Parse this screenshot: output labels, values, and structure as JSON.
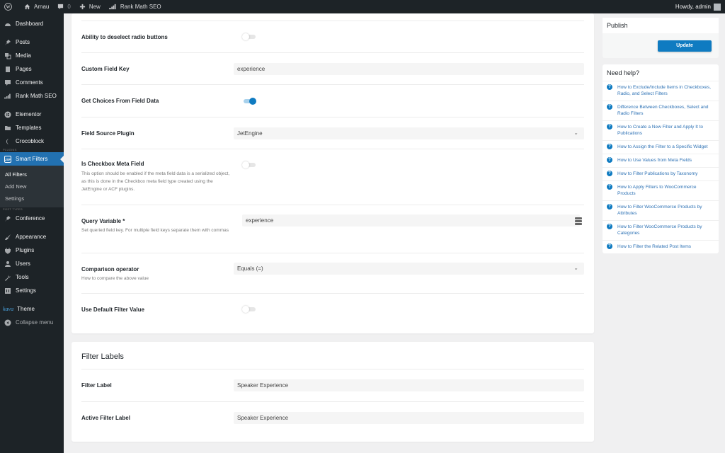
{
  "adminbar": {
    "site_name": "Arnau",
    "comments_count": "0",
    "new_label": "New",
    "rankmath_label": "Rank Math SEO",
    "howdy": "Howdy, admin"
  },
  "sidebar": {
    "items_top": [
      {
        "label": "Dashboard",
        "icon": "dashboard-icon"
      },
      {
        "label": "Posts",
        "icon": "pin-icon"
      },
      {
        "label": "Media",
        "icon": "media-icon"
      },
      {
        "label": "Pages",
        "icon": "pages-icon"
      },
      {
        "label": "Comments",
        "icon": "comment-icon"
      },
      {
        "label": "Rank Math SEO",
        "icon": "rankmath-icon"
      },
      {
        "label": "Elementor",
        "icon": "elementor-icon"
      },
      {
        "label": "Templates",
        "icon": "folder-icon"
      },
      {
        "label": "Crocoblock",
        "icon": "crocoblock-icon"
      }
    ],
    "plugins_sep": "PLUGINS",
    "active": {
      "label": "Smart Filters",
      "icon": "smart-filters-icon"
    },
    "submenu": [
      "All Filters",
      "Add New",
      "Settings"
    ],
    "post_types_sep": "POST TYPES",
    "conference": "Conference",
    "items_bottom": [
      {
        "label": "Appearance"
      },
      {
        "label": "Plugins"
      },
      {
        "label": "Users"
      },
      {
        "label": "Tools"
      },
      {
        "label": "Settings"
      }
    ],
    "theme_label": "Theme",
    "theme_logo": "kava",
    "collapse": "Collapse menu"
  },
  "settings": {
    "deselect_radio": {
      "label": "Ability to deselect radio buttons",
      "enabled": false
    },
    "custom_field_key": {
      "label": "Custom Field Key",
      "value": "experience"
    },
    "choices_from_field": {
      "label": "Get Choices From Field Data",
      "enabled": true
    },
    "field_source_plugin": {
      "label": "Field Source Plugin",
      "value": "JetEngine"
    },
    "checkbox_meta": {
      "label": "Is Checkbox Meta Field",
      "description": "This option should be enabled if the meta field data is a serialized object, as this is done in the Checkbox meta field type created using the JetEngine or ACF plugins.",
      "enabled": false
    },
    "query_variable": {
      "label": "Query Variable *",
      "description": "Set queried field key. For multiple field keys separate them with commas",
      "value": "experience"
    },
    "comparison": {
      "label": "Comparison operator",
      "description": "How to compare the above value",
      "value": "Equals (=)"
    },
    "default_value": {
      "label": "Use Default Filter Value",
      "enabled": false
    }
  },
  "filter_labels": {
    "title": "Filter Labels",
    "filter_label": {
      "label": "Filter Label",
      "value": "Speaker Experience"
    },
    "active_label": {
      "label": "Active Filter Label",
      "value": "Speaker Experience"
    }
  },
  "publish": {
    "title": "Publish",
    "update": "Update"
  },
  "help": {
    "title": "Need help?",
    "links": [
      "How to Exclude/Include Items in Checkboxes, Radio, and Select Filters",
      "Difference Between Checkboxes, Select and Radio Filters",
      "How to Create a New Filter and Apply It to Publications",
      "How to Assign the Filter to a Specific Widget",
      "How to Use Values from Meta Fields",
      "How to Filter Publications by Taxonomy",
      "How to Apply Filters to WooCommerce Products",
      "How to Filter WooCommerce Products by Attributes",
      "How to Filter WooCommerce Products by Categories",
      "How to Filter the Related Post Items"
    ]
  },
  "colors": {
    "accent": "#0f7bc1",
    "sidebar_bg": "#1d2327",
    "active_menu": "#2271b1"
  }
}
